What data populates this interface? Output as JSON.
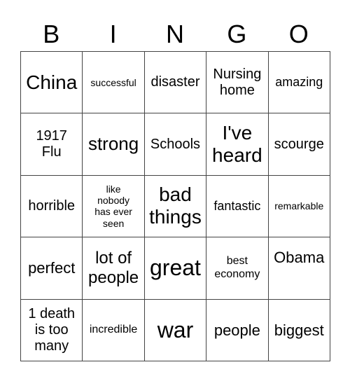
{
  "header": [
    "B",
    "I",
    "N",
    "G",
    "O"
  ],
  "rows": [
    [
      "China",
      "successful",
      "disaster",
      "Nursing\nhome",
      "amazing"
    ],
    [
      "1917\nFlu",
      "strong",
      "Schools",
      "I've\nheard",
      "scourge"
    ],
    [
      "horrible",
      "like\nnobody\nhas ever\nseen",
      "bad\nthings",
      "fantastic",
      "remarkable"
    ],
    [
      "perfect",
      "lot of\npeople",
      "great",
      "best\neconomy",
      "Obama"
    ],
    [
      "1 death\nis too\nmany",
      "incredible",
      "war",
      "people",
      "biggest"
    ]
  ]
}
